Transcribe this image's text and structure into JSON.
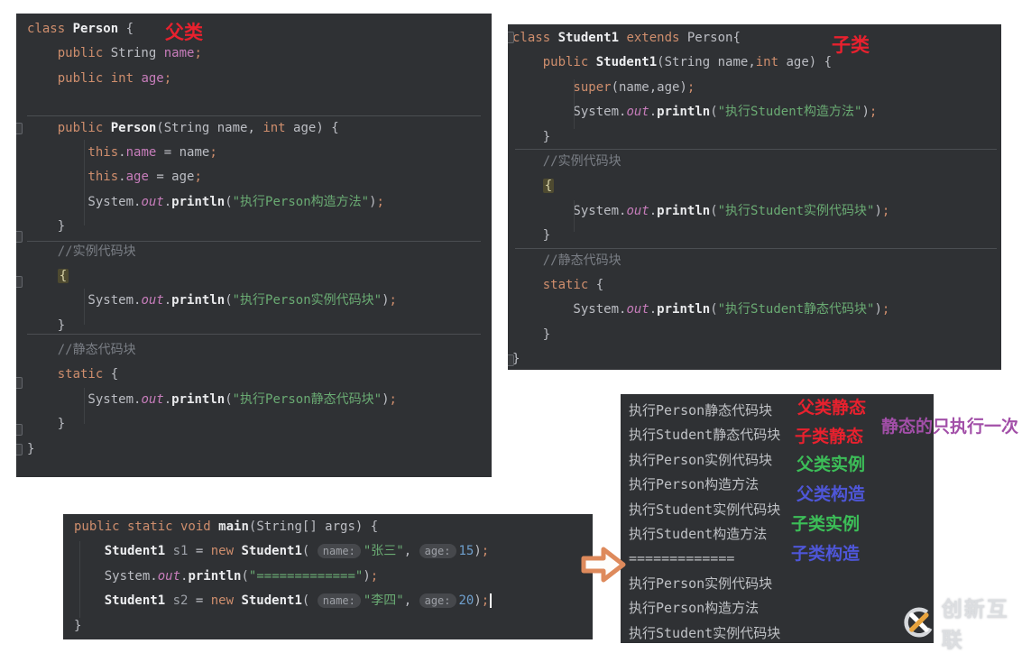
{
  "colors": {
    "panel_bg": "#2f3134",
    "annotation_red": "#E8212E",
    "annotation_green": "#3CBE58",
    "annotation_blue": "#4E56D8",
    "annotation_purple": "#A24FA8",
    "arrow_orange": "#DE8A5C",
    "keyword": "#CF8E6D",
    "string": "#6AAB73",
    "field": "#C77DBB",
    "number": "#6FA0CE",
    "comment": "#7A7E85"
  },
  "annotations": {
    "parent_class": {
      "text": "父类"
    },
    "child_class": {
      "text": "子类"
    },
    "parent_static": {
      "text": "父类静态"
    },
    "child_static": {
      "text": "子类静态"
    },
    "parent_instance": {
      "text": "父类实例"
    },
    "parent_ctor": {
      "text": "父类构造"
    },
    "child_instance": {
      "text": "子类实例"
    },
    "child_ctor": {
      "text": "子类构造"
    },
    "static_once": {
      "text": "静态的只执行一次"
    }
  },
  "panels": {
    "person": {
      "lines": [
        [
          [
            "kw",
            "class "
          ],
          [
            "cn",
            "Person "
          ],
          [
            "def",
            "{"
          ]
        ],
        [
          [
            "kw",
            "    public "
          ],
          [
            "typ",
            "String "
          ],
          [
            "fld",
            "name"
          ],
          [
            "semi",
            ";"
          ]
        ],
        [
          [
            "kw",
            "    public int "
          ],
          [
            "fld",
            "age"
          ],
          [
            "semi",
            ";"
          ]
        ],
        [],
        [
          [
            "kw",
            "    public "
          ],
          [
            "cn",
            "Person"
          ],
          [
            "def",
            "("
          ],
          [
            "typ",
            "String"
          ],
          [
            "def",
            " name, "
          ],
          [
            "kw",
            "int"
          ],
          [
            "def",
            " age) {"
          ]
        ],
        [
          [
            "kw",
            "        this"
          ],
          [
            "def",
            "."
          ],
          [
            "fld",
            "name"
          ],
          [
            "def",
            " = name"
          ],
          [
            "semi",
            ";"
          ]
        ],
        [
          [
            "kw",
            "        this"
          ],
          [
            "def",
            "."
          ],
          [
            "fld",
            "age"
          ],
          [
            "def",
            " = age"
          ],
          [
            "semi",
            ";"
          ]
        ],
        [
          [
            "def",
            "        System."
          ],
          [
            "out",
            "out"
          ],
          [
            "def",
            "."
          ],
          [
            "mth",
            "println"
          ],
          [
            "def",
            "("
          ],
          [
            "str",
            "\"执行Person构造方法\""
          ],
          [
            "def",
            ")"
          ],
          [
            "semi",
            ";"
          ]
        ],
        [
          [
            "def",
            "    }"
          ]
        ],
        [
          [
            "cmt",
            "    //实例代码块"
          ]
        ],
        [
          [
            "def",
            "    "
          ],
          [
            "hl",
            "{"
          ]
        ],
        [
          [
            "def",
            "        System."
          ],
          [
            "out",
            "out"
          ],
          [
            "def",
            "."
          ],
          [
            "mth",
            "println"
          ],
          [
            "def",
            "("
          ],
          [
            "str",
            "\"执行Person实例代码块\""
          ],
          [
            "def",
            ")"
          ],
          [
            "semi",
            ";"
          ]
        ],
        [
          [
            "def",
            "    }"
          ]
        ],
        [
          [
            "cmt",
            "    //静态代码块"
          ]
        ],
        [
          [
            "kw",
            "    static "
          ],
          [
            "def",
            "{"
          ]
        ],
        [
          [
            "def",
            "        System."
          ],
          [
            "out",
            "out"
          ],
          [
            "def",
            "."
          ],
          [
            "mth",
            "println"
          ],
          [
            "def",
            "("
          ],
          [
            "str",
            "\"执行Person静态代码块\""
          ],
          [
            "def",
            ")"
          ],
          [
            "semi",
            ";"
          ]
        ],
        [
          [
            "def",
            "    }"
          ]
        ],
        [
          [
            "def",
            "}"
          ]
        ]
      ]
    },
    "student": {
      "lines": [
        [
          [
            "kw",
            "class "
          ],
          [
            "cn",
            "Student1 "
          ],
          [
            "kw",
            "extends "
          ],
          [
            "def",
            "Person{"
          ]
        ],
        [
          [
            "kw",
            "    public "
          ],
          [
            "cn",
            "Student1"
          ],
          [
            "def",
            "("
          ],
          [
            "typ",
            "String"
          ],
          [
            "def",
            " name,"
          ],
          [
            "kw",
            "int"
          ],
          [
            "def",
            " age) {"
          ]
        ],
        [
          [
            "kw",
            "        super"
          ],
          [
            "def",
            "(name,age)"
          ],
          [
            "semi",
            ";"
          ]
        ],
        [
          [
            "def",
            "        System."
          ],
          [
            "out",
            "out"
          ],
          [
            "def",
            "."
          ],
          [
            "mth",
            "println"
          ],
          [
            "def",
            "("
          ],
          [
            "str",
            "\"执行Student构造方法\""
          ],
          [
            "def",
            ")"
          ],
          [
            "semi",
            ";"
          ]
        ],
        [
          [
            "def",
            "    }"
          ]
        ],
        [
          [
            "cmt",
            "    //实例代码块"
          ]
        ],
        [
          [
            "def",
            "    "
          ],
          [
            "hl",
            "{"
          ]
        ],
        [
          [
            "def",
            "        System."
          ],
          [
            "out",
            "out"
          ],
          [
            "def",
            "."
          ],
          [
            "mth",
            "println"
          ],
          [
            "def",
            "("
          ],
          [
            "str",
            "\"执行Student实例代码块\""
          ],
          [
            "def",
            ")"
          ],
          [
            "semi",
            ";"
          ]
        ],
        [
          [
            "def",
            "    }"
          ]
        ],
        [
          [
            "cmt",
            "    //静态代码块"
          ]
        ],
        [
          [
            "kw",
            "    static "
          ],
          [
            "def",
            "{"
          ]
        ],
        [
          [
            "def",
            "        System."
          ],
          [
            "out",
            "out"
          ],
          [
            "def",
            "."
          ],
          [
            "mth",
            "println"
          ],
          [
            "def",
            "("
          ],
          [
            "str",
            "\"执行Student静态代码块\""
          ],
          [
            "def",
            ")"
          ],
          [
            "semi",
            ";"
          ]
        ],
        [
          [
            "def",
            "    }"
          ]
        ],
        [
          [
            "def",
            "}"
          ]
        ]
      ]
    },
    "main": {
      "lines": [
        [
          [
            "kw",
            "public static void "
          ],
          [
            "mth",
            "main"
          ],
          [
            "def",
            "("
          ],
          [
            "typ",
            "String"
          ],
          [
            "def",
            "[] args) {"
          ]
        ],
        [
          [
            "def",
            "    "
          ],
          [
            "cn",
            "Student1"
          ],
          [
            "var",
            " s1 "
          ],
          [
            "def",
            "= "
          ],
          [
            "kw",
            "new "
          ],
          [
            "cn",
            "Student1"
          ],
          [
            "def",
            "( "
          ],
          [
            "hint",
            "name:"
          ],
          [
            "str",
            "\"张三\""
          ],
          [
            "def",
            ", "
          ],
          [
            "hint",
            "age:"
          ],
          [
            "num",
            "15"
          ],
          [
            "def",
            ")"
          ],
          [
            "semi",
            ";"
          ]
        ],
        [
          [
            "def",
            "    System."
          ],
          [
            "out",
            "out"
          ],
          [
            "def",
            "."
          ],
          [
            "mth",
            "println"
          ],
          [
            "def",
            "("
          ],
          [
            "str",
            "\"=============\""
          ],
          [
            "def",
            ")"
          ],
          [
            "semi",
            ";"
          ]
        ],
        [
          [
            "def",
            "    "
          ],
          [
            "cn",
            "Student1"
          ],
          [
            "var",
            " s2 "
          ],
          [
            "def",
            "= "
          ],
          [
            "kw",
            "new "
          ],
          [
            "cn",
            "Student1"
          ],
          [
            "def",
            "( "
          ],
          [
            "hint",
            "name:"
          ],
          [
            "str",
            "\"李四\""
          ],
          [
            "def",
            ", "
          ],
          [
            "hint",
            "age:"
          ],
          [
            "num",
            "20"
          ],
          [
            "def",
            ")"
          ],
          [
            "semi",
            ";"
          ],
          [
            "caret",
            ""
          ]
        ],
        [
          [
            "def",
            "}"
          ]
        ]
      ]
    },
    "output": {
      "lines": [
        [
          [
            "con",
            "执行Person静态代码块"
          ]
        ],
        [
          [
            "con",
            "执行Student静态代码块"
          ]
        ],
        [
          [
            "con",
            "执行Person实例代码块"
          ]
        ],
        [
          [
            "con",
            "执行Person构造方法"
          ]
        ],
        [
          [
            "con",
            "执行Student实例代码块"
          ]
        ],
        [
          [
            "con",
            "执行Student构造方法"
          ]
        ],
        [
          [
            "con",
            "============="
          ]
        ],
        [
          [
            "con",
            "执行Person实例代码块"
          ]
        ],
        [
          [
            "con",
            "执行Person构造方法"
          ]
        ],
        [
          [
            "con",
            "执行Student实例代码块"
          ]
        ]
      ]
    }
  },
  "watermark": {
    "text": "创新互联"
  }
}
